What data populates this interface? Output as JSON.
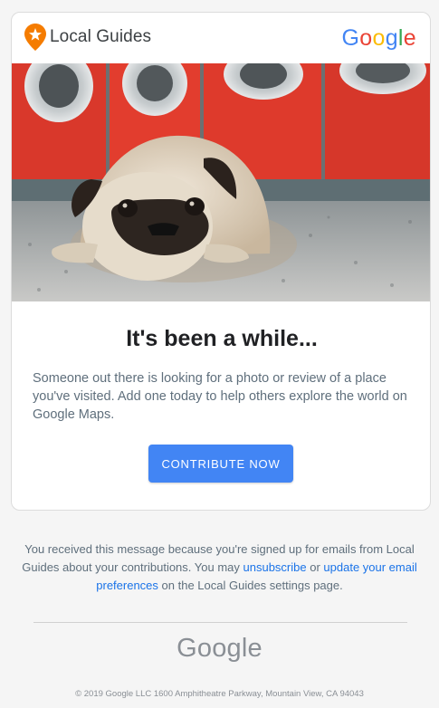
{
  "header": {
    "brand_label": "Local Guides",
    "google_logo": [
      "G",
      "o",
      "o",
      "g",
      "l",
      "e"
    ],
    "brand_icon": "local-guides-pin-icon"
  },
  "hero": {
    "image": "pug-lying-in-laundromat"
  },
  "main": {
    "headline": "It's been a while...",
    "body": "Someone out there is looking for a photo or review of a place you've visited. Add one today to help others explore the world on Google Maps.",
    "cta_label": "CONTRIBUTE NOW"
  },
  "footer": {
    "text_before": "You received this message because you're signed up for emails from Local Guides about your contributions. You may ",
    "unsubscribe_link": "unsubscribe",
    "text_or": " or ",
    "preferences_link": "update your email preferences",
    "text_after": " on the Local Guides settings page.",
    "logo": "Google",
    "copyright": "© 2019 Google LLC 1600 Amphitheatre Parkway, Mountain View, CA 94043"
  },
  "colors": {
    "cta": "#4285f4",
    "link": "#1a73e8",
    "brand_orange": "#f57c00"
  }
}
